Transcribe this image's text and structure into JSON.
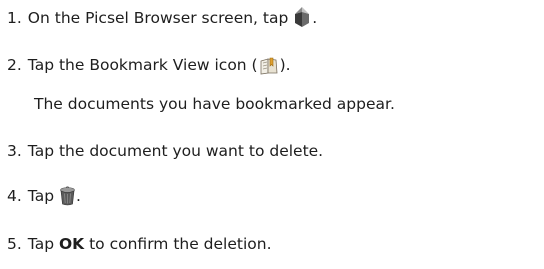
{
  "steps": [
    {
      "number": "1.",
      "before": "On the Picsel Browser screen, tap",
      "icon": "picsel-home-icon",
      "after": "."
    },
    {
      "number": "2.",
      "before": "Tap the Bookmark View icon (",
      "icon": "bookmark-view-icon",
      "after": ").",
      "note": "The documents you have bookmarked appear."
    },
    {
      "number": "3.",
      "text": "Tap the document you want to delete."
    },
    {
      "number": "4.",
      "before": "Tap",
      "icon": "trash-icon",
      "after": "."
    },
    {
      "number": "5.",
      "before": "Tap",
      "bold": "OK",
      "after": "to confirm the deletion."
    }
  ]
}
